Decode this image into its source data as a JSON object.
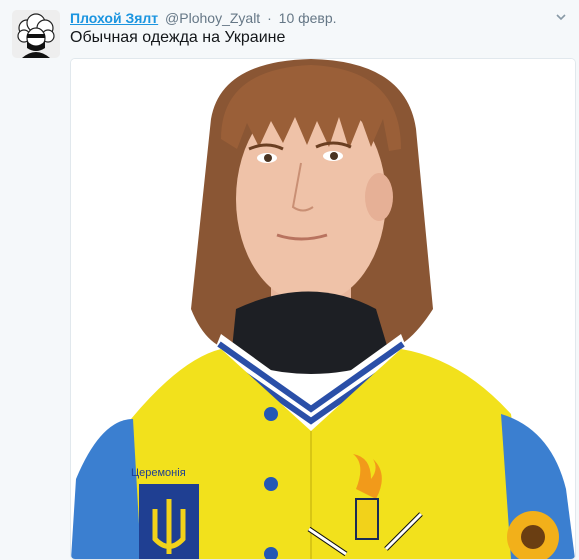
{
  "tweet": {
    "author_name": "Плохой Зялт",
    "author_handle": "@Plohoy_Zyalt",
    "separator": "·",
    "timestamp": "10 февр.",
    "text": "Обычная одежда на Украине",
    "photo": {
      "description_hidden": false,
      "patch_text": "Церемонія"
    }
  },
  "colors": {
    "link": "#1b95e0",
    "secondary": "#657786",
    "text": "#14171a",
    "jacket_yellow": "#f2e11c",
    "sleeve_blue": "#3b7fd0"
  },
  "icons": {
    "caret": "chevron-down-icon",
    "avatar": "bandana-face-avatar"
  }
}
